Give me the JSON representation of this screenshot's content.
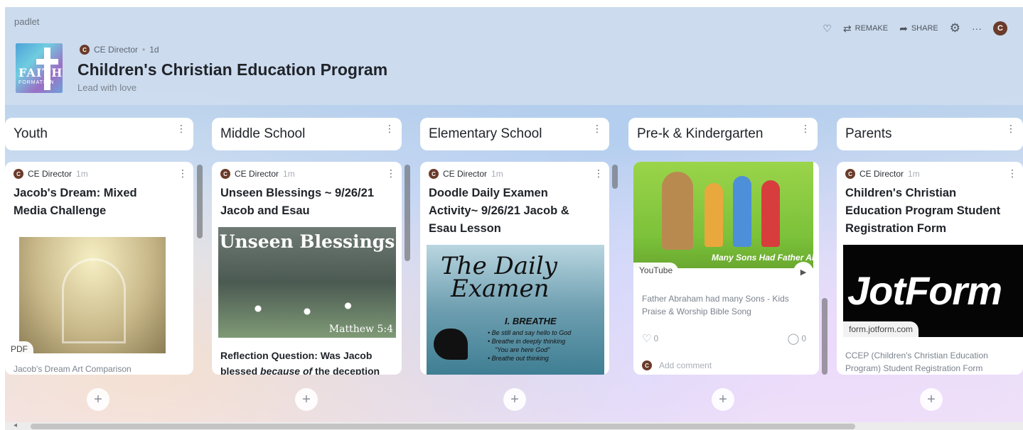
{
  "app": {
    "brand": "padlet"
  },
  "board": {
    "author": "CE Director",
    "author_initial": "C",
    "age": "1d",
    "title": "Children's Christian Education Program",
    "subtitle": "Lead with love",
    "logo_text": "FAITH",
    "logo_sub": "FORMATION"
  },
  "actions": {
    "remake": "REMAKE",
    "share": "SHARE",
    "more": "···",
    "user_initial": "C"
  },
  "columns": [
    {
      "title": "Youth"
    },
    {
      "title": "Middle School"
    },
    {
      "title": "Elementary School"
    },
    {
      "title": "Pre-k & Kindergarten"
    },
    {
      "title": "Parents"
    }
  ],
  "cards": {
    "youth": {
      "author": "CE Director",
      "time": "1m",
      "title_line1": "Jacob's Dream: Mixed",
      "title_line2": "Media Challenge",
      "chip": "PDF",
      "caption": "Jacob's Dream Art Comparison"
    },
    "middle": {
      "author": "CE Director",
      "time": "1m",
      "title_line1": "Unseen Blessings ~ 9/26/21",
      "title_line2": "Jacob and Esau",
      "image_title": "Unseen Blessings",
      "image_ref": "Matthew 5:4",
      "body_line1": "Reflection Question: Was Jacob",
      "body_line2_pre": "blessed ",
      "body_line2_em": "because of",
      "body_line2_post": " the deception"
    },
    "elementary": {
      "author": "CE Director",
      "time": "1m",
      "title_line1": "Doodle Daily Examen",
      "title_line2": "Activity~ 9/26/21 Jacob &",
      "title_line3": "Esau Lesson",
      "image_title1": "The Daily",
      "image_title2": "Examen",
      "image_step": "I. BREATHE",
      "image_b1": "• Be still and say hello to God",
      "image_b2": "• Breathe in deeply thinking",
      "image_b3": "\"You are here God\"",
      "image_b4": "• Breathe out thinking"
    },
    "prek": {
      "chip": "YouTube",
      "image_banner": "Many Sons Had Father Abraham",
      "caption_line1": "Father Abraham had many Sons - Kids",
      "caption_line2": "Praise & Worship Bible Song",
      "likes": "0",
      "comments": "0",
      "add_comment": "Add comment"
    },
    "parents": {
      "author": "CE Director",
      "time": "1m",
      "title_line1": "Children's Christian",
      "title_line2": "Education Program Student",
      "title_line3": "Registration Form",
      "image_text": "JotForm",
      "chip": "form.jotform.com",
      "caption_line1": "CCEP (Children's Christian Education",
      "caption_line2": "Program) Student Registration Form"
    }
  },
  "add_label": "+"
}
